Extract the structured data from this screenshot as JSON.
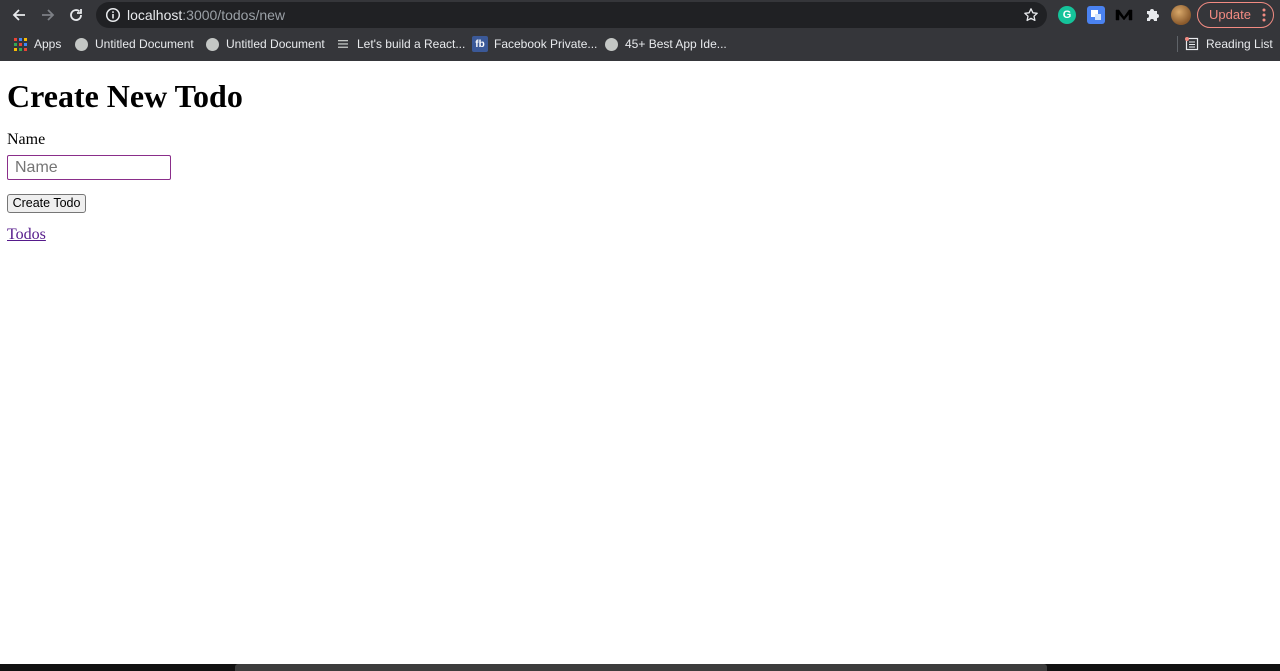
{
  "browser": {
    "url_host": "localhost",
    "url_path": ":3000/todos/new",
    "update_label": "Update",
    "reading_list_label": "Reading List",
    "bookmarks": [
      {
        "label": "Apps",
        "icon": "apps-grid-icon"
      },
      {
        "label": "Untitled Document",
        "icon": "globe-icon"
      },
      {
        "label": "Untitled Document",
        "icon": "globe-icon"
      },
      {
        "label": "Let's build a React...",
        "icon": "menu-lines-icon"
      },
      {
        "label": "Facebook Private...",
        "icon": "fb-icon"
      },
      {
        "label": "45+ Best App Ide...",
        "icon": "globe-icon"
      }
    ],
    "extensions": {
      "grammarly_letter": "G",
      "fb_letters": "fb"
    }
  },
  "page": {
    "title": "Create New Todo",
    "name_label": "Name",
    "name_placeholder": "Name",
    "name_value": "",
    "submit_label": "Create Todo",
    "todos_link": "Todos"
  }
}
